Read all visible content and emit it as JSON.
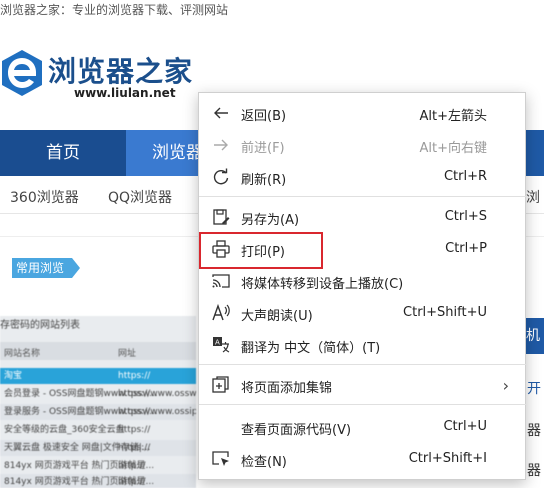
{
  "notice": "浏览器之家：专业的浏览器下载、评测网站",
  "logo": {
    "name": "浏览器之家",
    "url": "www.liulan.net"
  },
  "nav": {
    "home": "首页",
    "browser": "浏览器"
  },
  "subnav": {
    "item1": "360浏览器",
    "item2": "QQ浏览器",
    "edge": "浏"
  },
  "section_tag": "常用浏览",
  "thumb": {
    "title": "存密码的网站列表",
    "col1": "网站名称",
    "col2": "网址",
    "rows": [
      {
        "name": "淘宝",
        "url": "https://"
      },
      {
        "name": "会员登录 - OSS网盘题钢www.ossw...",
        "url": "https://www.ossw..."
      },
      {
        "name": "登录服务 - OSS网盘题钢www.ossw...",
        "url": "https://www.ossip.com"
      },
      {
        "name": "安全等级的云盘_360安全云盘",
        "url": "https://"
      },
      {
        "name": "天翼云盘 极速安全 网盘|文件存储|...",
        "url": "https://"
      },
      {
        "name": "814yx 网页游戏平台 热门页游就是...",
        "url": "http://"
      },
      {
        "name": "814yx 网页游戏平台 热门页游就是...",
        "url": "http://"
      }
    ]
  },
  "right": {
    "bar": "机",
    "frag1": "开",
    "frag2": "器",
    "frag3": "器"
  },
  "menu": {
    "items": [
      {
        "label": "返回(B)",
        "shortcut": "Alt+左箭头",
        "icon": "back-arrow-icon"
      },
      {
        "label": "前进(F)",
        "shortcut": "Alt+向右键",
        "icon": "forward-arrow-icon"
      },
      {
        "label": "刷新(R)",
        "shortcut": "Ctrl+R",
        "icon": "refresh-icon"
      },
      {
        "label": "另存为(A)",
        "shortcut": "Ctrl+S",
        "icon": "save-as-icon"
      },
      {
        "label": "打印(P)",
        "shortcut": "Ctrl+P",
        "icon": "print-icon"
      },
      {
        "label": "将媒体转移到设备上播放(C)",
        "shortcut": "",
        "icon": "cast-icon"
      },
      {
        "label": "大声朗读(U)",
        "shortcut": "Ctrl+Shift+U",
        "icon": "read-aloud-icon"
      },
      {
        "label": "翻译为 中文（简体）(T)",
        "shortcut": "",
        "icon": "translate-icon"
      },
      {
        "label": "将页面添加集锦",
        "shortcut": "",
        "icon": "collections-icon"
      },
      {
        "label": "查看页面源代码(V)",
        "shortcut": "Ctrl+U",
        "icon": ""
      },
      {
        "label": "检查(N)",
        "shortcut": "Ctrl+Shift+I",
        "icon": "inspect-icon"
      }
    ]
  },
  "colors": {
    "nav": "#1f5aa6",
    "highlight": "#d9272e",
    "tag": "#4aa6e0"
  }
}
